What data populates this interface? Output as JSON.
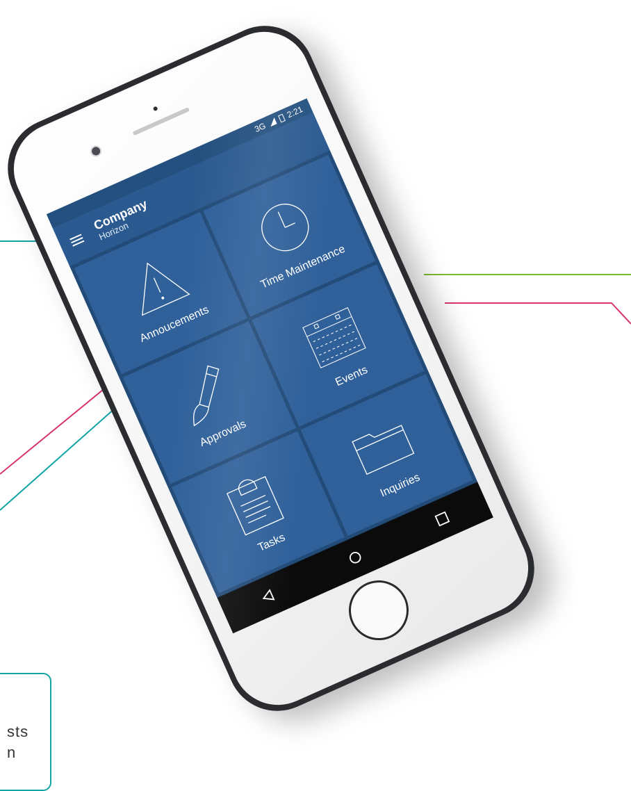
{
  "page": {
    "callout_text_line1": "sts",
    "callout_text_line2": "n"
  },
  "phone": {
    "status_bar": {
      "network": "3G",
      "time": "2:21"
    },
    "app_bar": {
      "title": "Company",
      "subtitle": "Horizon",
      "menu_icon": "hamburger-menu-icon"
    },
    "tiles": [
      {
        "label": "Annoucements",
        "icon": "warning-triangle-icon"
      },
      {
        "label": "Time Maintenance",
        "icon": "clock-icon"
      },
      {
        "label": "Approvals",
        "icon": "paintbrush-icon"
      },
      {
        "label": "Events",
        "icon": "calendar-icon"
      },
      {
        "label": "Tasks",
        "icon": "clipboard-icon"
      },
      {
        "label": "Inquiries",
        "icon": "folder-icon"
      }
    ],
    "nav": [
      {
        "icon": "back-triangle-icon"
      },
      {
        "icon": "home-circle-icon"
      },
      {
        "icon": "recents-square-icon"
      }
    ]
  },
  "colors": {
    "screen_blue": "#2d5b93",
    "callout_teal": "#12a3a3",
    "callout_green": "#7dbb2f",
    "callout_pink": "#d8346d"
  }
}
